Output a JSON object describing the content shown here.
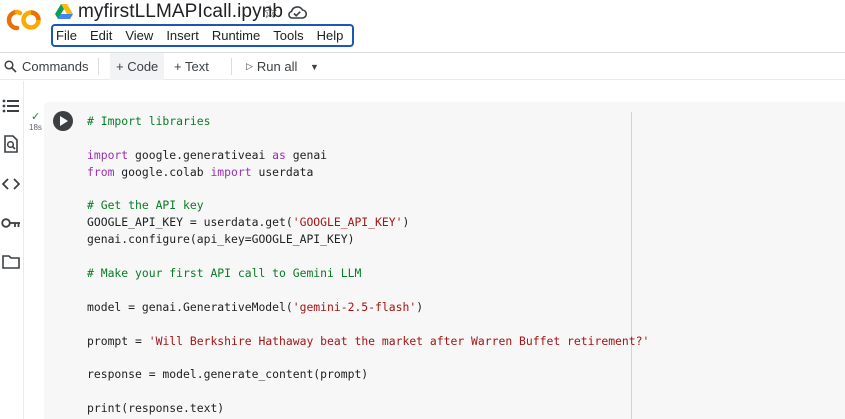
{
  "app": {
    "title": "myfirstLLMAPIcall.ipynb"
  },
  "menu": [
    "File",
    "Edit",
    "View",
    "Insert",
    "Runtime",
    "Tools",
    "Help"
  ],
  "toolbar": {
    "commands": "Commands",
    "code": "+ Code",
    "text": "+ Text",
    "run_all": "Run all"
  },
  "icons": {
    "logo": "colab-logo",
    "drive": "drive-icon",
    "star": "star-icon",
    "cloud": "cloud-icon",
    "rail": [
      "list-icon",
      "find-icon",
      "code-icon",
      "key-icon",
      "folder-icon"
    ]
  },
  "cell": {
    "exec_time": "18s",
    "lines": [
      [
        {
          "t": "# Import libraries",
          "c": "cm"
        }
      ],
      [],
      [
        {
          "t": "import",
          "c": "kw"
        },
        {
          "t": " google.generativeai ",
          "c": "nm"
        },
        {
          "t": "as",
          "c": "kw"
        },
        {
          "t": " genai",
          "c": "nm"
        }
      ],
      [
        {
          "t": "from",
          "c": "kw"
        },
        {
          "t": " google.colab ",
          "c": "nm"
        },
        {
          "t": "import",
          "c": "kw"
        },
        {
          "t": " userdata",
          "c": "nm"
        }
      ],
      [],
      [
        {
          "t": "# Get the API key",
          "c": "cm"
        }
      ],
      [
        {
          "t": "GOOGLE_API_KEY = userdata.get(",
          "c": "nm"
        },
        {
          "t": "'GOOGLE_API_KEY'",
          "c": "st"
        },
        {
          "t": ")",
          "c": "nm"
        }
      ],
      [
        {
          "t": "genai.configure(api_key=GOOGLE_API_KEY)",
          "c": "nm"
        }
      ],
      [],
      [
        {
          "t": "# Make your first API call to Gemini LLM",
          "c": "cm"
        }
      ],
      [],
      [
        {
          "t": "model = genai.GenerativeModel(",
          "c": "nm"
        },
        {
          "t": "'gemini-2.5-flash'",
          "c": "st"
        },
        {
          "t": ")",
          "c": "nm"
        }
      ],
      [],
      [
        {
          "t": "prompt = ",
          "c": "nm"
        },
        {
          "t": "'Will Berkshire Hathaway beat the market after Warren Buffet retirement?'",
          "c": "st"
        }
      ],
      [],
      [
        {
          "t": "response = model.generate_content(prompt)",
          "c": "nm"
        }
      ],
      [],
      [
        {
          "t": "print(response.text)",
          "c": "nm"
        }
      ]
    ]
  },
  "colors": {
    "menu_highlight": "#1a57b8",
    "comment": "#0a7b25",
    "keyword": "#9a31b0",
    "string": "#a31515",
    "cell_bg": "#f7f7f7",
    "logo_orange": "#f9ab00",
    "logo_dark_orange": "#e8710a"
  }
}
